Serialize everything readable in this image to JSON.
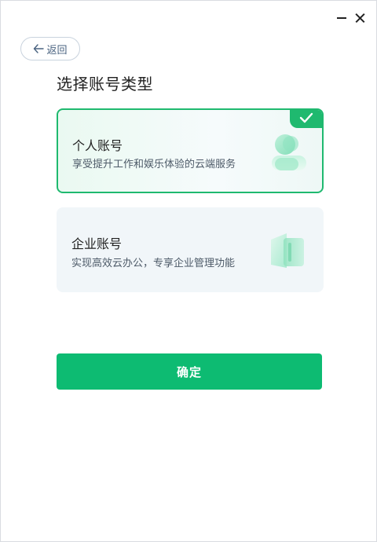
{
  "window": {
    "minimize_icon": "minimize-icon",
    "close_icon": "close-icon"
  },
  "back_button": {
    "label": "返回",
    "icon": "arrow-left-icon"
  },
  "page_title": "选择账号类型",
  "account_types": [
    {
      "title": "个人账号",
      "description": "享受提升工作和娱乐体验的云端服务",
      "selected": true,
      "icon": "person-icon"
    },
    {
      "title": "企业账号",
      "description": "实现高效云办公，专享企业管理功能",
      "selected": false,
      "icon": "building-icon"
    }
  ],
  "confirm_button": {
    "label": "确定"
  },
  "colors": {
    "accent": "#0dbb72",
    "selected_border": "#1fb96f",
    "enterprise_card_bg": "#f1f6f9"
  }
}
